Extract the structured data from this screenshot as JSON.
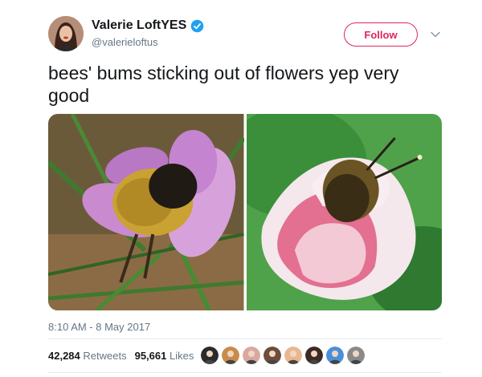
{
  "author": {
    "display_name": "Valerie LoftYES",
    "handle": "@valerieloftus",
    "verified": true
  },
  "follow_button_label": "Follow",
  "tweet": {
    "text": "bees' bums sticking out of flowers yep very good"
  },
  "media": {
    "photos": [
      {
        "subject": "bee in purple crocus"
      },
      {
        "subject": "bee in pink and white flower"
      }
    ]
  },
  "timestamp": "8:10 AM - 8 May 2017",
  "stats": {
    "retweets_count": "42,284",
    "retweets_label": "Retweets",
    "likes_count": "95,661",
    "likes_label": "Likes"
  },
  "colors": {
    "accent": "#e0245e",
    "verified": "#1da1f2",
    "muted": "#657786",
    "text": "#14171a"
  },
  "likers": [
    {
      "color": "#2b2b2b"
    },
    {
      "color": "#c98b4a"
    },
    {
      "color": "#d9a8a0"
    },
    {
      "color": "#6b4d3a"
    },
    {
      "color": "#e8b790"
    },
    {
      "color": "#3c2a24"
    },
    {
      "color": "#4a90d9"
    },
    {
      "color": "#8a8a8a"
    }
  ]
}
